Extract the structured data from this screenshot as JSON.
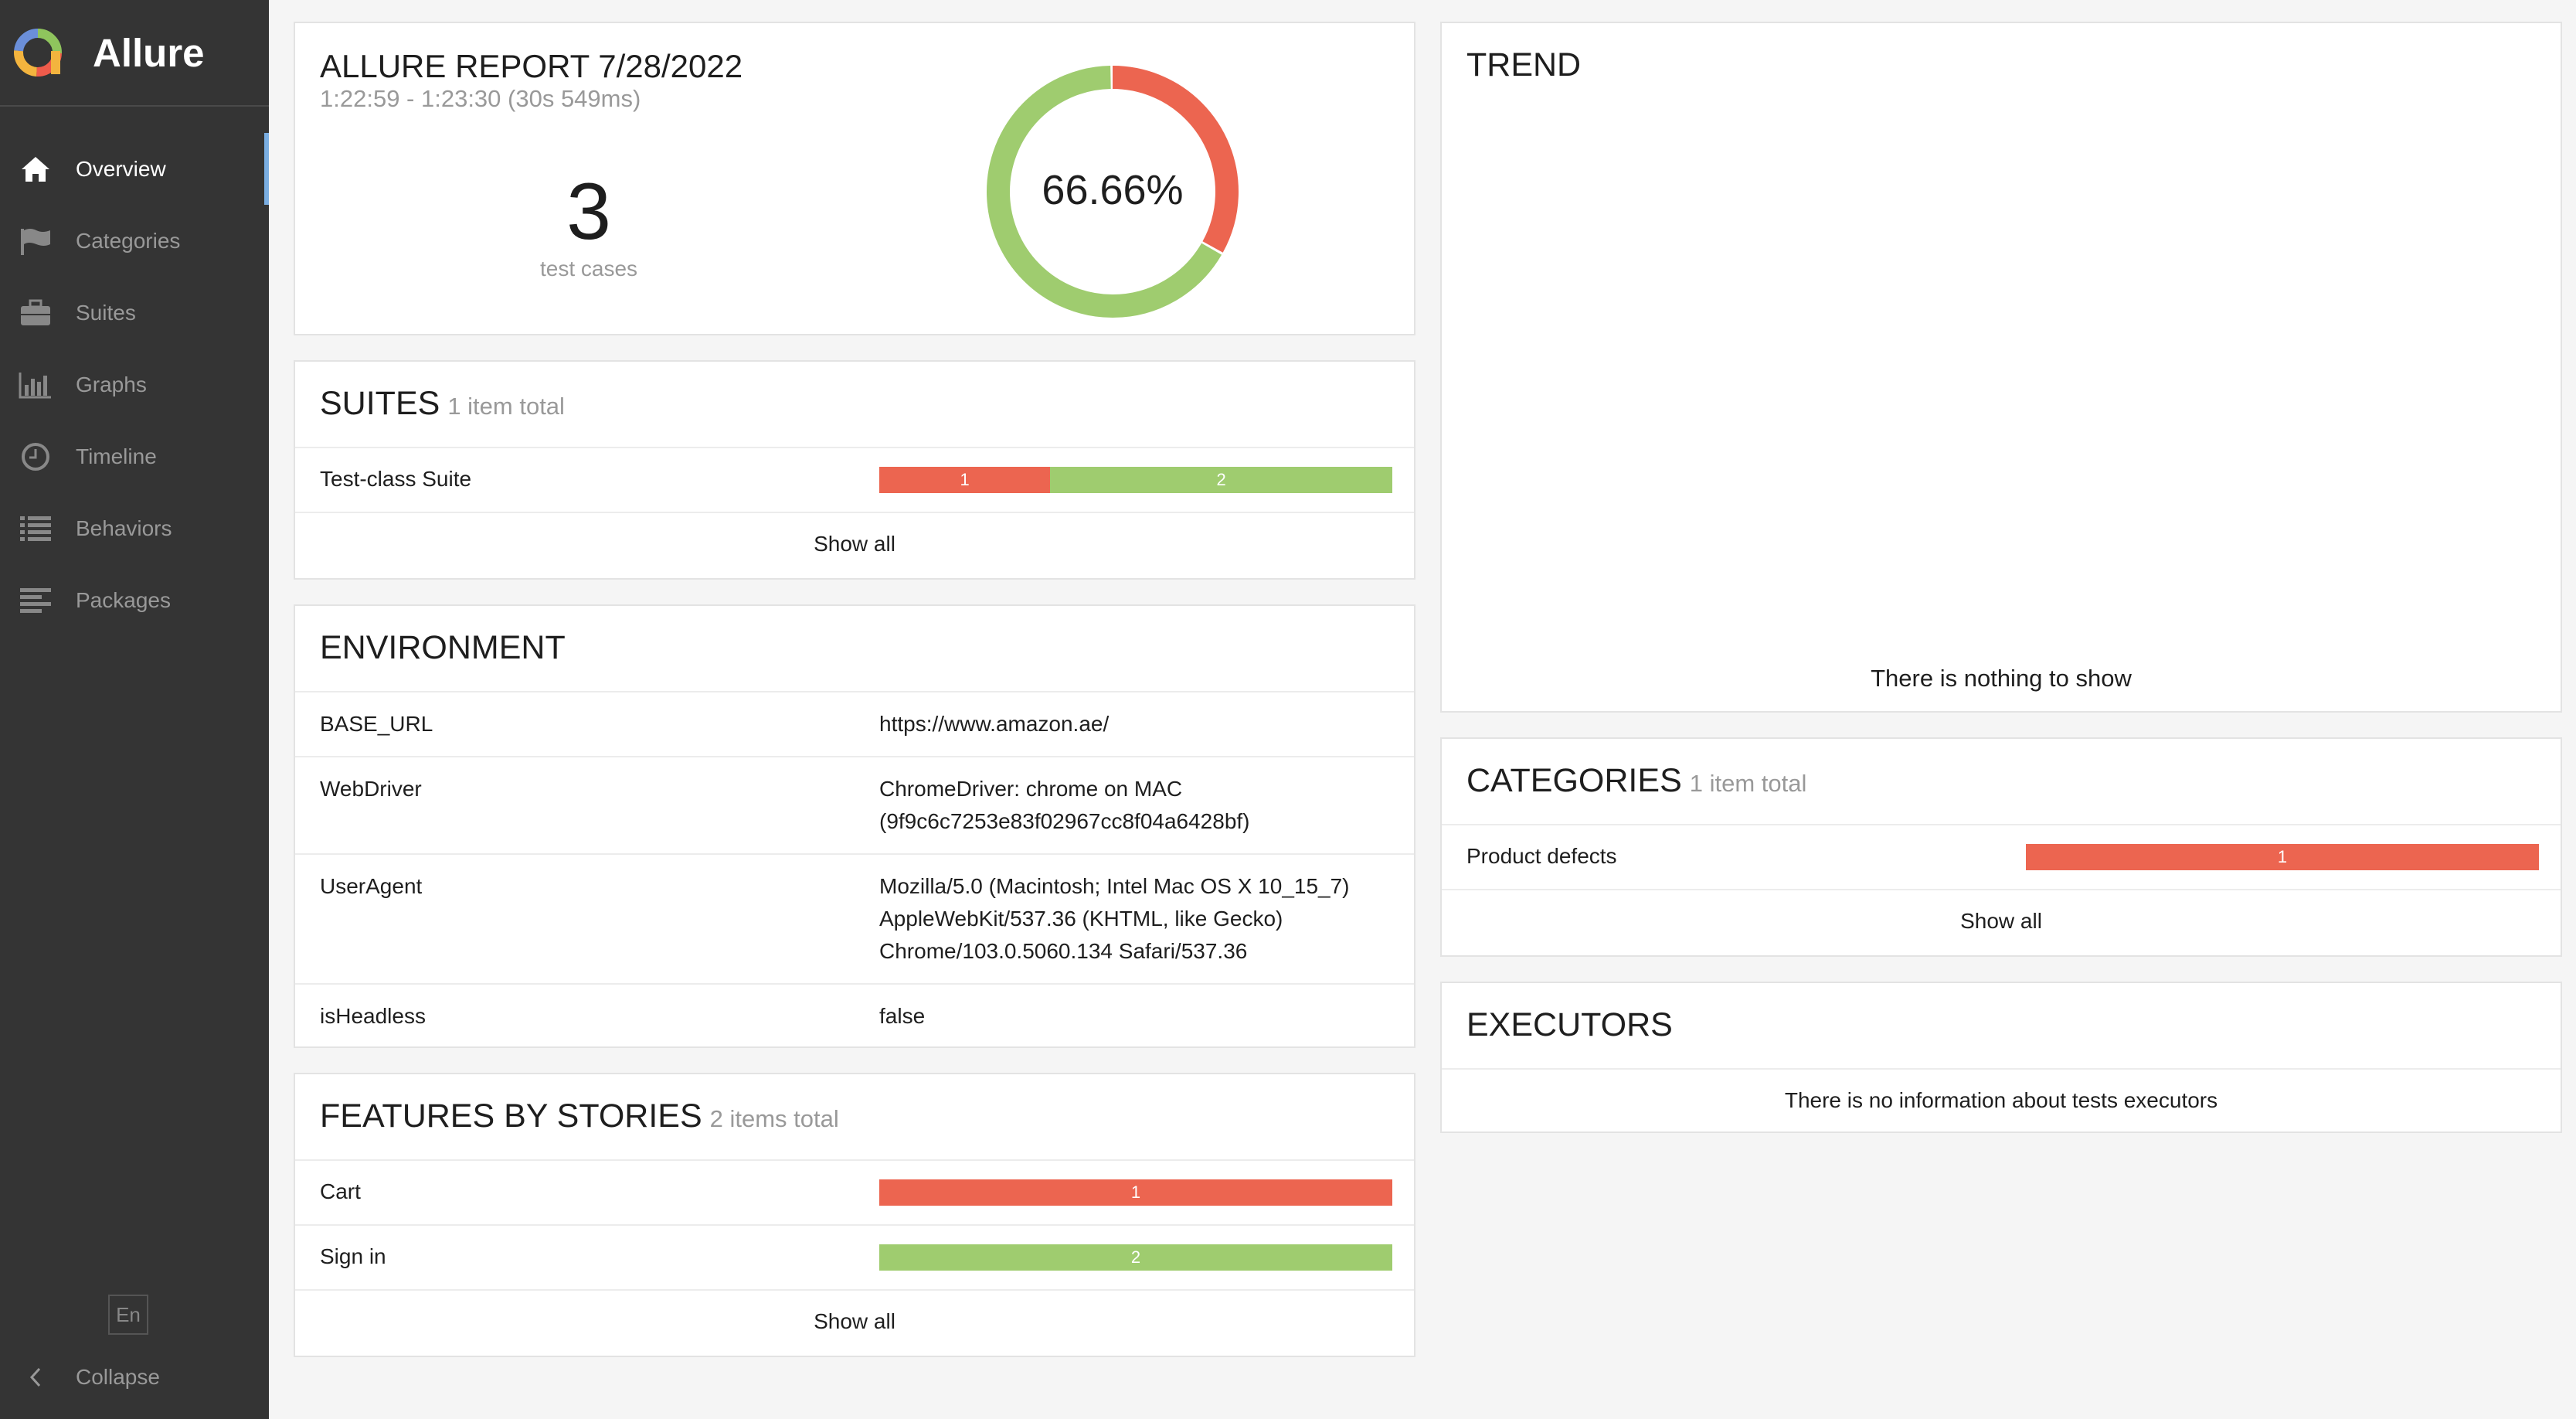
{
  "app": {
    "name": "Allure"
  },
  "sidebar": {
    "items": [
      {
        "label": "Overview",
        "icon": "home-icon",
        "active": true
      },
      {
        "label": "Categories",
        "icon": "flag-icon",
        "active": false
      },
      {
        "label": "Suites",
        "icon": "briefcase-icon",
        "active": false
      },
      {
        "label": "Graphs",
        "icon": "bar-chart-icon",
        "active": false
      },
      {
        "label": "Timeline",
        "icon": "clock-icon",
        "active": false
      },
      {
        "label": "Behaviors",
        "icon": "list-icon",
        "active": false
      },
      {
        "label": "Packages",
        "icon": "align-left-icon",
        "active": false
      }
    ],
    "language": "En",
    "collapse_label": "Collapse"
  },
  "summary": {
    "title": "ALLURE REPORT 7/28/2022",
    "time": "1:22:59 - 1:23:30 (30s 549ms)",
    "test_count": "3",
    "test_count_label": "test cases",
    "percent": "66.66%",
    "passed_fraction": 0.6666,
    "failed_fraction": 0.3334
  },
  "suites": {
    "title": "SUITES",
    "total": "1 item total",
    "rows": [
      {
        "name": "Test-class Suite",
        "failed": 1,
        "passed": 2,
        "failed_label": "1",
        "passed_label": "2"
      }
    ],
    "show_all": "Show all"
  },
  "environment": {
    "title": "ENVIRONMENT",
    "rows": [
      {
        "name": "BASE_URL",
        "lines": [
          "https://www.amazon.ae/"
        ]
      },
      {
        "name": "WebDriver",
        "lines": [
          "ChromeDriver: chrome on MAC",
          "(9f9c6c7253e83f02967cc8f04a6428bf)"
        ]
      },
      {
        "name": "UserAgent",
        "lines": [
          "Mozilla/5.0 (Macintosh; Intel Mac OS X 10_15_7)",
          "AppleWebKit/537.36 (KHTML, like Gecko)",
          "Chrome/103.0.5060.134 Safari/537.36"
        ]
      },
      {
        "name": "isHeadless",
        "lines": [
          "false"
        ]
      }
    ]
  },
  "features": {
    "title": "FEATURES BY STORIES",
    "total": "2 items total",
    "rows": [
      {
        "name": "Cart",
        "failed": 1,
        "passed": 0,
        "label": "1",
        "status": "failed"
      },
      {
        "name": "Sign in",
        "failed": 0,
        "passed": 2,
        "label": "2",
        "status": "passed"
      }
    ],
    "show_all": "Show all"
  },
  "trend": {
    "title": "TREND",
    "empty": "There is nothing to show"
  },
  "categories": {
    "title": "CATEGORIES",
    "total": "1 item total",
    "rows": [
      {
        "name": "Product defects",
        "label": "1",
        "status": "failed"
      }
    ],
    "show_all": "Show all"
  },
  "executors": {
    "title": "EXECUTORS",
    "empty": "There is no information about tests executors"
  },
  "colors": {
    "failed": "#ec6550",
    "passed": "#9fcc6f",
    "sidebar": "#343434",
    "accent": "#7aaee2"
  }
}
